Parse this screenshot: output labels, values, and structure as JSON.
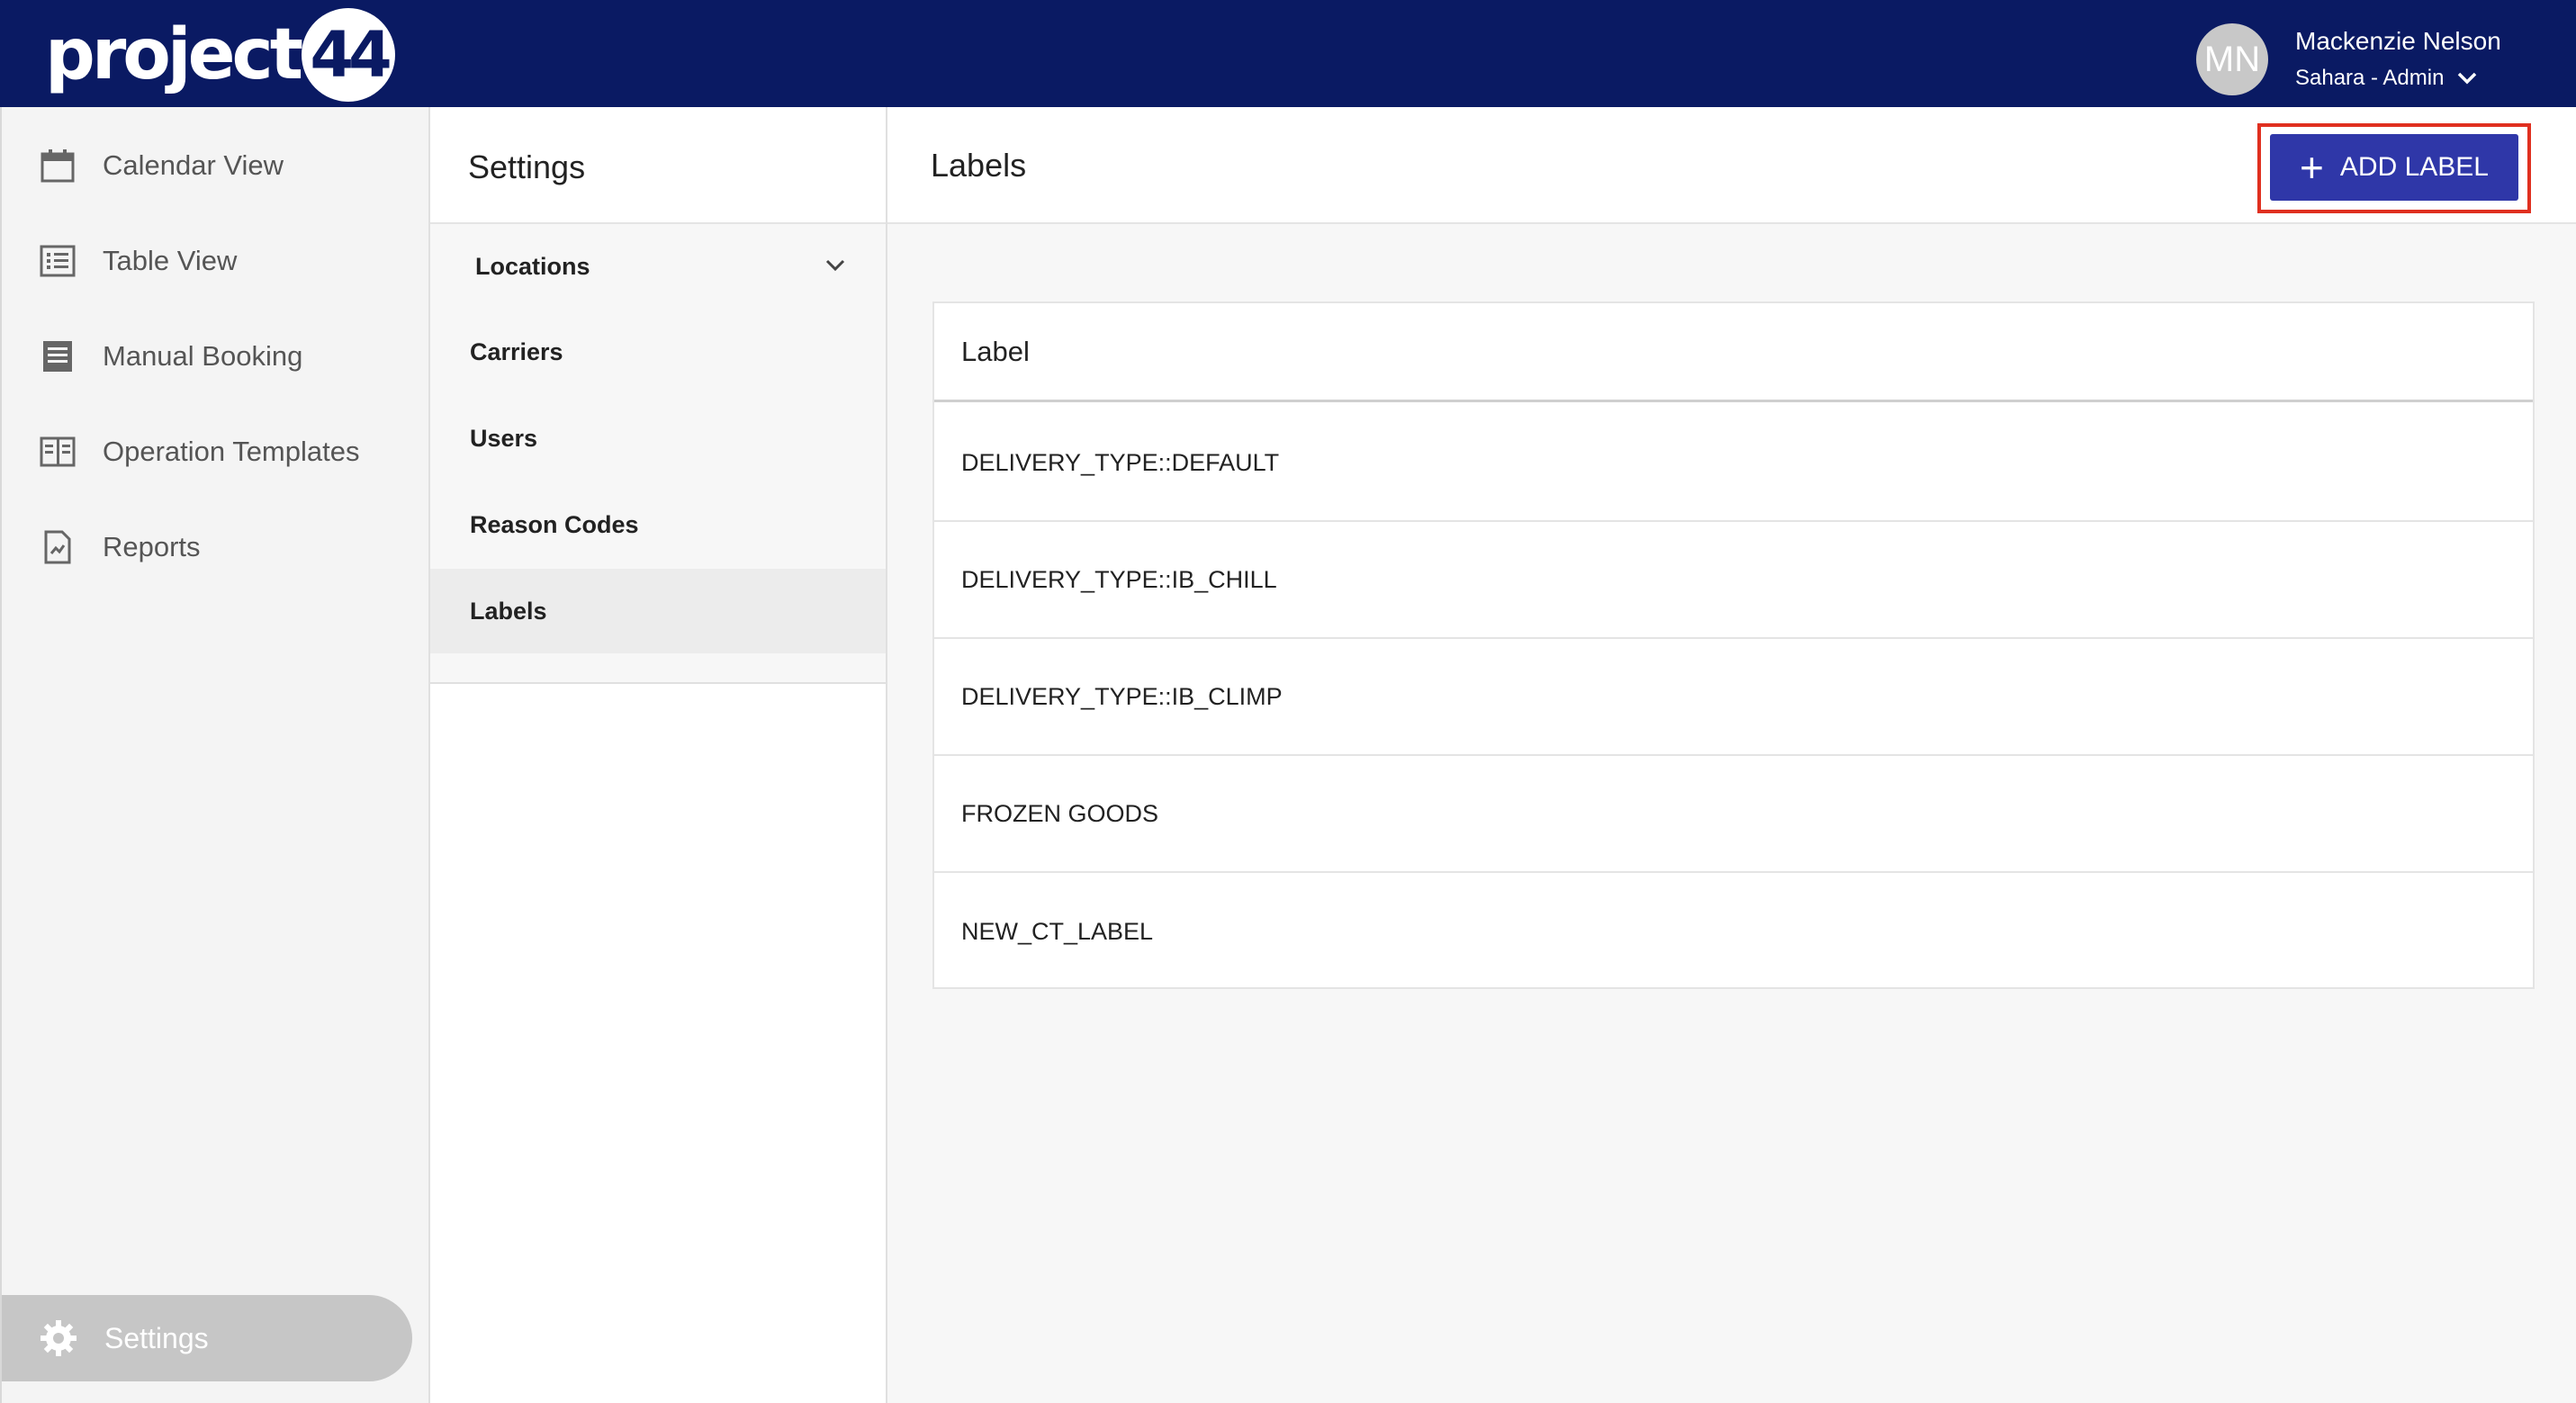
{
  "brand": {
    "logo_text": "project",
    "logo_badge": "44"
  },
  "user": {
    "initials": "MN",
    "name": "Mackenzie Nelson",
    "role": "Sahara - Admin"
  },
  "sidebar": {
    "items": [
      {
        "label": "Calendar View",
        "icon": "calendar-icon"
      },
      {
        "label": "Table View",
        "icon": "list-icon"
      },
      {
        "label": "Manual Booking",
        "icon": "document-icon"
      },
      {
        "label": "Operation Templates",
        "icon": "book-icon"
      },
      {
        "label": "Reports",
        "icon": "report-icon"
      }
    ],
    "settings_label": "Settings"
  },
  "settings_menu": {
    "title": "Settings",
    "items": [
      "Locations",
      "Carriers",
      "Users",
      "Reason Codes",
      "Labels"
    ],
    "active": "Labels"
  },
  "main": {
    "title": "Labels",
    "add_button": "ADD LABEL",
    "table": {
      "header": "Label",
      "rows": [
        "DELIVERY_TYPE::DEFAULT",
        "DELIVERY_TYPE::IB_CHILL",
        "DELIVERY_TYPE::IB_CLIMP",
        "FROZEN GOODS",
        "NEW_CT_LABEL"
      ]
    }
  },
  "colors": {
    "header_bg": "#0a1a63",
    "button_bg": "#2f37a8",
    "highlight_outline": "#e03020"
  }
}
